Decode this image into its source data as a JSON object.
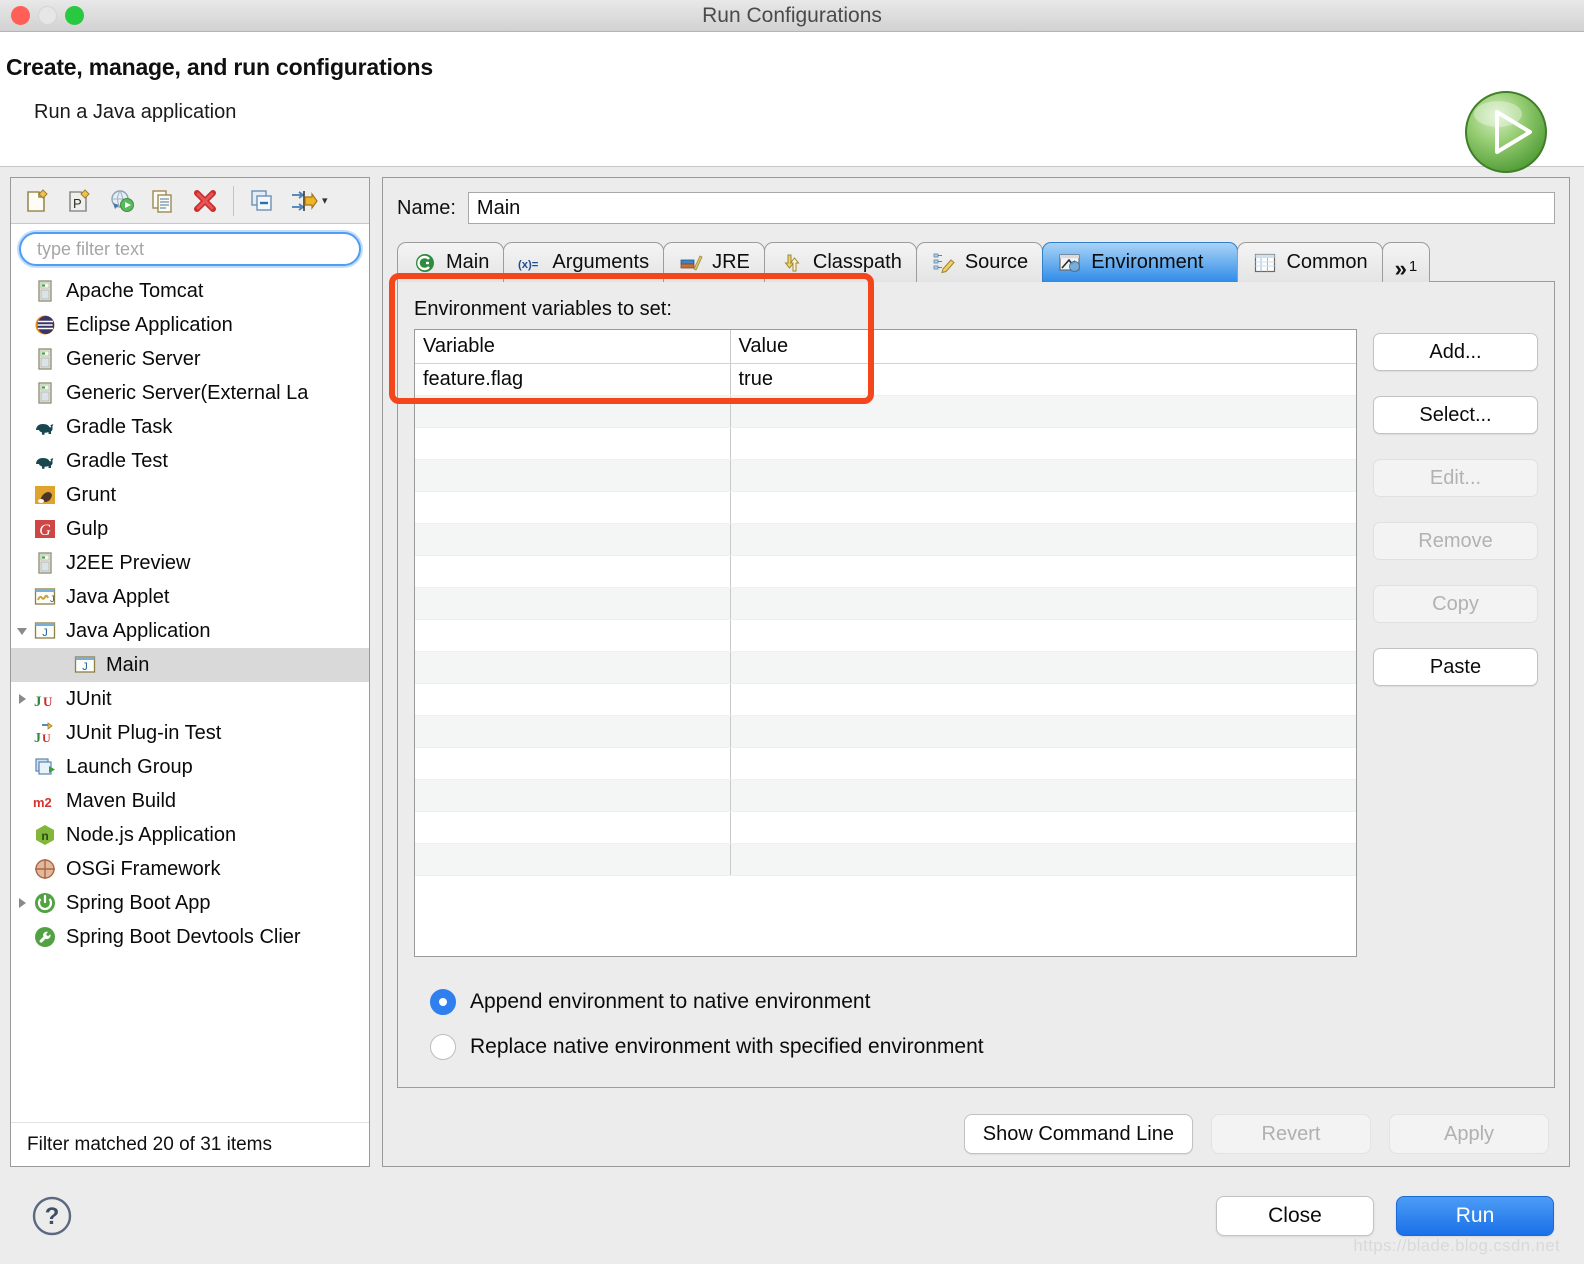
{
  "window": {
    "title": "Run Configurations",
    "traffic_lights": [
      "close",
      "minimize",
      "maximize"
    ]
  },
  "header": {
    "heading": "Create, manage, and run configurations",
    "subheading": "Run a Java application",
    "icon": "run-green-play-icon"
  },
  "left_panel": {
    "toolbar": [
      {
        "name": "new-configuration-icon",
        "label": "New launch configuration"
      },
      {
        "name": "new-prototype-icon",
        "label": "New prototype"
      },
      {
        "name": "export-icon",
        "label": "Export"
      },
      {
        "name": "duplicate-icon",
        "label": "Duplicate"
      },
      {
        "name": "delete-icon",
        "label": "Delete"
      },
      {
        "name": "collapse-all-icon",
        "label": "Collapse All"
      },
      {
        "name": "filter-icon",
        "label": "Filter"
      }
    ],
    "filter": {
      "placeholder": "type filter text",
      "value": ""
    },
    "tree": [
      {
        "label": "Apache Tomcat",
        "icon": "server-icon",
        "indent": 0,
        "twisty": "none",
        "selected": false
      },
      {
        "label": "Eclipse Application",
        "icon": "eclipse-icon",
        "indent": 0,
        "twisty": "none",
        "selected": false
      },
      {
        "label": "Generic Server",
        "icon": "server-icon",
        "indent": 0,
        "twisty": "none",
        "selected": false
      },
      {
        "label": "Generic Server(External La",
        "icon": "server-icon",
        "indent": 0,
        "twisty": "none",
        "selected": false
      },
      {
        "label": "Gradle Task",
        "icon": "gradle-elephant-icon",
        "indent": 0,
        "twisty": "none",
        "selected": false
      },
      {
        "label": "Gradle Test",
        "icon": "gradle-elephant-icon",
        "indent": 0,
        "twisty": "none",
        "selected": false
      },
      {
        "label": "Grunt",
        "icon": "grunt-icon",
        "indent": 0,
        "twisty": "none",
        "selected": false
      },
      {
        "label": "Gulp",
        "icon": "gulp-icon",
        "indent": 0,
        "twisty": "none",
        "selected": false
      },
      {
        "label": "J2EE Preview",
        "icon": "server-icon",
        "indent": 0,
        "twisty": "none",
        "selected": false
      },
      {
        "label": "Java Applet",
        "icon": "java-applet-icon",
        "indent": 0,
        "twisty": "none",
        "selected": false
      },
      {
        "label": "Java Application",
        "icon": "java-application-icon",
        "indent": 0,
        "twisty": "expanded",
        "selected": false
      },
      {
        "label": "Main",
        "icon": "java-application-icon",
        "indent": 1,
        "twisty": "none",
        "selected": true
      },
      {
        "label": "JUnit",
        "icon": "junit-icon",
        "indent": 0,
        "twisty": "collapsed",
        "selected": false
      },
      {
        "label": "JUnit Plug-in Test",
        "icon": "junit-plugin-icon",
        "indent": 0,
        "twisty": "none",
        "selected": false
      },
      {
        "label": "Launch Group",
        "icon": "launch-group-icon",
        "indent": 0,
        "twisty": "none",
        "selected": false
      },
      {
        "label": "Maven Build",
        "icon": "maven-icon",
        "indent": 0,
        "twisty": "none",
        "selected": false
      },
      {
        "label": "Node.js Application",
        "icon": "nodejs-icon",
        "indent": 0,
        "twisty": "none",
        "selected": false
      },
      {
        "label": "OSGi Framework",
        "icon": "osgi-icon",
        "indent": 0,
        "twisty": "none",
        "selected": false
      },
      {
        "label": "Spring Boot App",
        "icon": "spring-boot-icon",
        "indent": 0,
        "twisty": "collapsed",
        "selected": false
      },
      {
        "label": "Spring Boot Devtools Clier",
        "icon": "spring-devtools-icon",
        "indent": 0,
        "twisty": "none",
        "selected": false
      }
    ],
    "status": "Filter matched 20 of 31 items"
  },
  "right_panel": {
    "name_label": "Name:",
    "name_value": "Main",
    "tabs": [
      {
        "label": "Main",
        "icon": "main-class-icon",
        "active": false
      },
      {
        "label": "Arguments",
        "icon": "arguments-icon",
        "active": false
      },
      {
        "label": "JRE",
        "icon": "jre-books-icon",
        "active": false
      },
      {
        "label": "Classpath",
        "icon": "classpath-icon",
        "active": false
      },
      {
        "label": "Source",
        "icon": "source-pencil-icon",
        "active": false
      },
      {
        "label": "Environment",
        "icon": "environment-icon",
        "active": true
      },
      {
        "label": "Common",
        "icon": "common-table-icon",
        "active": false
      }
    ],
    "overflow_tab": {
      "chevron": "»",
      "count": "1"
    },
    "environment": {
      "section_label": "Environment variables to set:",
      "columns": [
        "Variable",
        "Value"
      ],
      "rows": [
        {
          "variable": "feature.flag",
          "value": "true"
        }
      ],
      "empty_row_count": 15,
      "buttons": [
        {
          "label": "Add...",
          "enabled": true
        },
        {
          "label": "Select...",
          "enabled": true
        },
        {
          "label": "Edit...",
          "enabled": false
        },
        {
          "label": "Remove",
          "enabled": false
        },
        {
          "label": "Copy",
          "enabled": false
        },
        {
          "label": "Paste",
          "enabled": true
        }
      ],
      "radio_options": [
        {
          "label": "Append environment to native environment",
          "selected": true
        },
        {
          "label": "Replace native environment with specified environment",
          "selected": false
        }
      ]
    },
    "actions": [
      {
        "label": "Show Command Line",
        "enabled": true
      },
      {
        "label": "Revert",
        "enabled": false
      },
      {
        "label": "Apply",
        "enabled": false
      }
    ]
  },
  "footer": {
    "help_icon": "help-question-icon",
    "close_label": "Close",
    "run_label": "Run",
    "watermark": "https://blade.blog.csdn.net"
  },
  "annotation": {
    "color": "#f5451b",
    "target": "environment-variables-table-highlight"
  }
}
